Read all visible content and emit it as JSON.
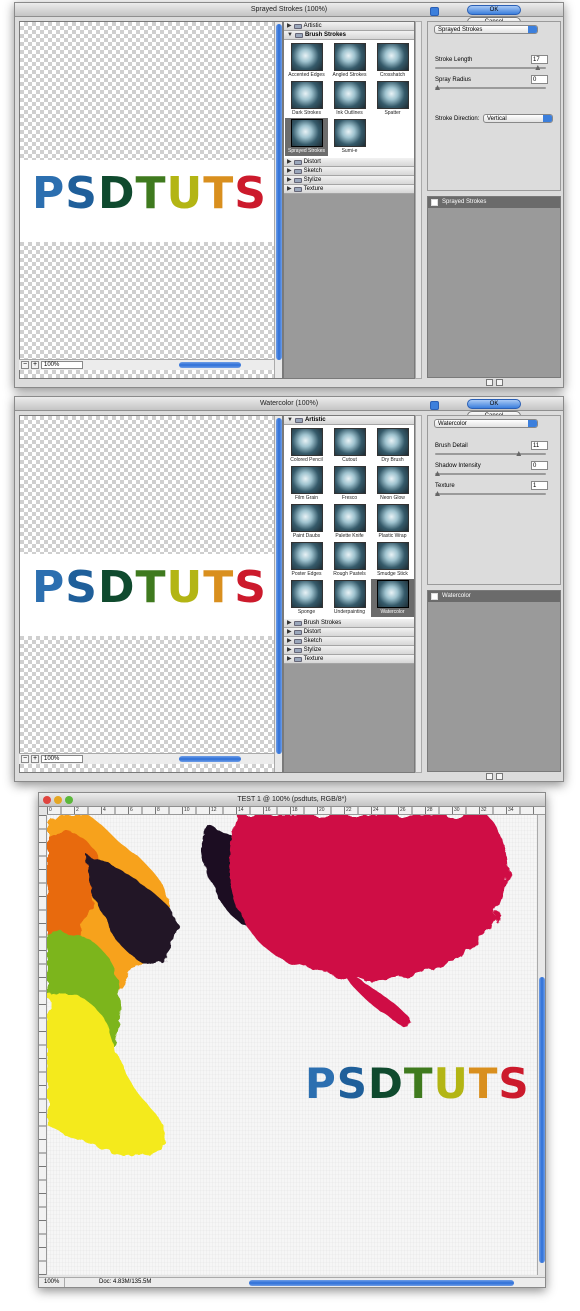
{
  "colors": {
    "accent": "#3c7fdc",
    "letters": [
      "#2c6fb0",
      "#1f6aa8",
      "#0f4a2e",
      "#1a5a25",
      "#5b8a1a",
      "#a8b516",
      "#d6a21a",
      "#d4412a",
      "#c8142c"
    ]
  },
  "psd_letters": [
    "P",
    "S",
    "D",
    "T",
    "U",
    "T",
    "S"
  ],
  "psd_colors": [
    "#2c6fb0",
    "#1f5f9a",
    "#0f4a2e",
    "#3f7a1e",
    "#b3b514",
    "#d98f1e",
    "#cc1a2c"
  ],
  "dialog1": {
    "title": "Sprayed Strokes (100%)",
    "zoom": "100%",
    "ok": "OK",
    "cancel": "Cancel",
    "filter": "Sprayed Strokes",
    "categories_top": [
      {
        "label": "Artistic",
        "open": false
      },
      {
        "label": "Brush Strokes",
        "open": true
      }
    ],
    "thumbs": [
      {
        "label": "Accented Edges"
      },
      {
        "label": "Angled Strokes"
      },
      {
        "label": "Crosshatch"
      },
      {
        "label": "Dark Strokes"
      },
      {
        "label": "Ink Outlines"
      },
      {
        "label": "Spatter"
      },
      {
        "label": "Sprayed Strokes",
        "selected": true
      },
      {
        "label": "Sumi-e"
      }
    ],
    "categories_bottom": [
      "Distort",
      "Sketch",
      "Stylize",
      "Texture"
    ],
    "params": [
      {
        "label": "Stroke Length",
        "value": "17",
        "pos": 0.95
      },
      {
        "label": "Spray Radius",
        "value": "0",
        "pos": 0.0
      }
    ],
    "direction_label": "Stroke Direction:",
    "direction_value": "Vertical",
    "layer": "Sprayed Strokes"
  },
  "dialog2": {
    "title": "Watercolor (100%)",
    "zoom": "100%",
    "ok": "OK",
    "cancel": "Cancel",
    "filter": "Watercolor",
    "categories_top": [
      {
        "label": "Artistic",
        "open": true
      }
    ],
    "thumbs": [
      {
        "label": "Colored Pencil"
      },
      {
        "label": "Cutout"
      },
      {
        "label": "Dry Brush"
      },
      {
        "label": "Film Grain"
      },
      {
        "label": "Fresco"
      },
      {
        "label": "Neon Glow"
      },
      {
        "label": "Paint Daubs"
      },
      {
        "label": "Palette Knife"
      },
      {
        "label": "Plastic Wrap"
      },
      {
        "label": "Poster Edges"
      },
      {
        "label": "Rough Pastels"
      },
      {
        "label": "Smudge Stick"
      },
      {
        "label": "Sponge"
      },
      {
        "label": "Underpainting"
      },
      {
        "label": "Watercolor",
        "selected": true
      }
    ],
    "categories_bottom": [
      "Brush Strokes",
      "Distort",
      "Sketch",
      "Stylize",
      "Texture"
    ],
    "params": [
      {
        "label": "Brush Detail",
        "value": "11",
        "pos": 0.77
      },
      {
        "label": "Shadow Intensity",
        "value": "0",
        "pos": 0.0
      },
      {
        "label": "Texture",
        "value": "1",
        "pos": 0.0
      }
    ],
    "layer": "Watercolor"
  },
  "document": {
    "title": "TEST 1 @ 100% (psdtuts, RGB/8*)",
    "zoom": "100%",
    "doc_size": "Doc: 4.83M/135.5M",
    "ruler_labels": [
      "0",
      "2",
      "4",
      "6",
      "8",
      "10",
      "12",
      "14",
      "16",
      "18",
      "20",
      "22",
      "24",
      "26",
      "28",
      "30",
      "32",
      "34"
    ]
  }
}
